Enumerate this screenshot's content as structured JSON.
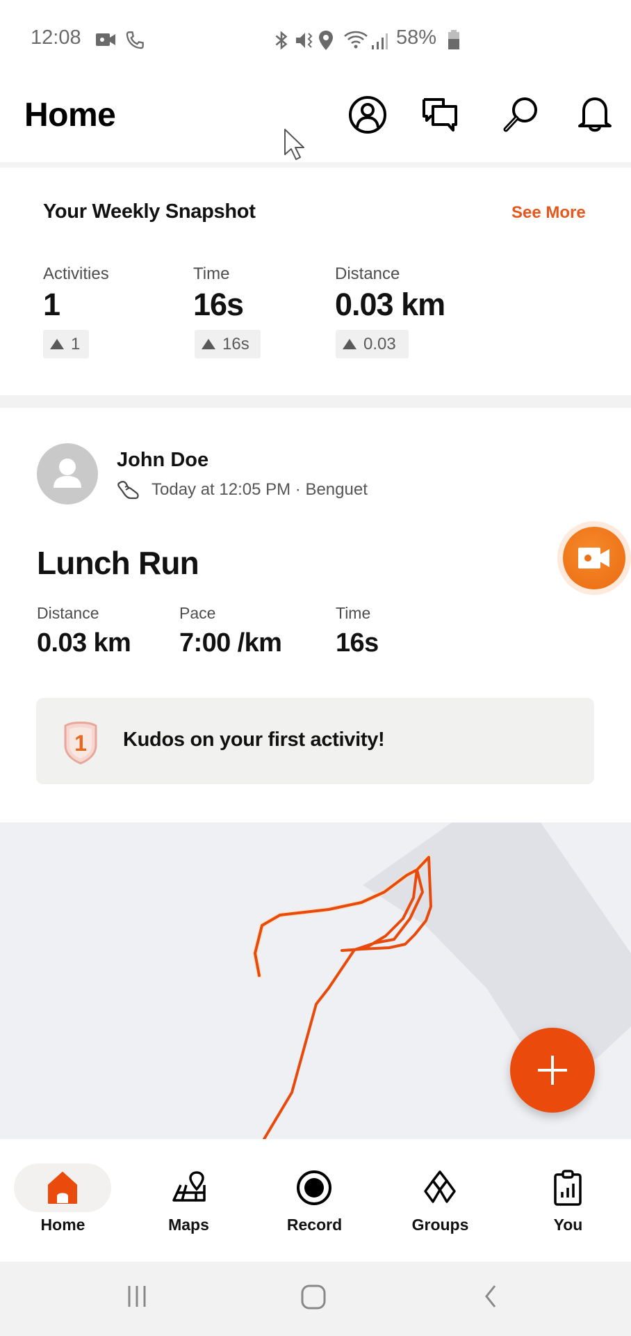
{
  "status_bar": {
    "time": "12:08",
    "battery": "58%",
    "left_icons": [
      "video-recording-icon",
      "phone-call-icon"
    ],
    "right_icons": [
      "bluetooth-icon",
      "mute-vibrate-icon",
      "location-icon",
      "wifi-icon",
      "signal-icon",
      "battery-icon"
    ]
  },
  "header": {
    "title": "Home",
    "icons": [
      "profile-icon",
      "chat-icon",
      "search-icon",
      "notifications-bell-icon"
    ]
  },
  "weekly_snapshot": {
    "title": "Your Weekly Snapshot",
    "see_more": "See More",
    "stats": [
      {
        "label": "Activities",
        "value": "1",
        "change": "1"
      },
      {
        "label": "Time",
        "value": "16s",
        "change": "16s"
      },
      {
        "label": "Distance",
        "value": "0.03 km",
        "change": "0.03"
      }
    ]
  },
  "activity": {
    "athlete": "John Doe",
    "meta": "Today at 12:05 PM · Benguet",
    "sport_icon": "running-shoe-icon",
    "title": "Lunch Run",
    "stats": [
      {
        "label": "Distance",
        "value": "0.03 km"
      },
      {
        "label": "Pace",
        "value": "7:00 /km"
      },
      {
        "label": "Time",
        "value": "16s"
      }
    ],
    "kudos_message": "Kudos on your first activity!",
    "kudos_badge_number": "1"
  },
  "colors": {
    "brand": "#fc5200",
    "accent_text": "#e8561b",
    "route": "#e84a0c",
    "fab": "#ea4a0c",
    "video_fab": "#f07a1f"
  },
  "bottom_nav": {
    "items": [
      {
        "label": "Home",
        "icon": "home-icon",
        "active": true
      },
      {
        "label": "Maps",
        "icon": "maps-icon",
        "active": false
      },
      {
        "label": "Record",
        "icon": "record-icon",
        "active": false
      },
      {
        "label": "Groups",
        "icon": "groups-icon",
        "active": false
      },
      {
        "label": "You",
        "icon": "you-clipboard-icon",
        "active": false
      }
    ]
  },
  "system_nav": [
    "recent-apps-icon",
    "home-button-icon",
    "back-icon"
  ]
}
